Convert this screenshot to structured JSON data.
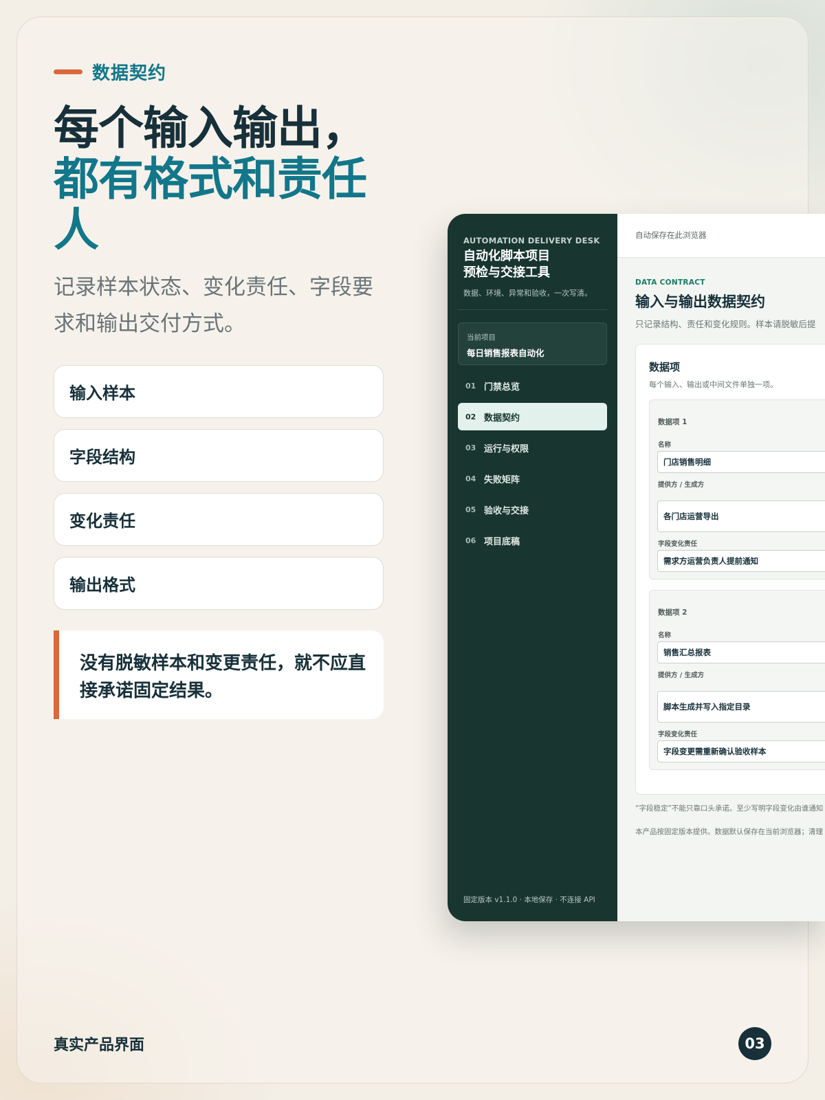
{
  "slide": {
    "eyebrow": "数据契约",
    "headline_line1": "每个输入输出，",
    "headline_line2": "都有格式和责任人",
    "subtitle": "记录样本状态、变化责任、字段要求和输出交付方式。",
    "chips": [
      "输入样本",
      "字段结构",
      "变化责任",
      "输出格式"
    ],
    "callout": "没有脱敏样本和变更责任，就不应直接承诺固定结果。",
    "footer_label": "真实产品界面",
    "page_number": "03",
    "colors": {
      "accent_orange": "#d9683a",
      "accent_teal": "#12778a",
      "ink": "#17303a",
      "sidebar": "#18352f"
    }
  },
  "app": {
    "sidebar": {
      "kicker": "AUTOMATION DELIVERY DESK",
      "title_line1": "自动化脚本项目",
      "title_line2": "预检与交接工具",
      "subtitle": "数据、环境、异常和验收，一次写清。",
      "project_label": "当前项目",
      "project_name": "每日销售报表自动化",
      "nav": [
        {
          "num": "01",
          "label": "门禁总览",
          "active": false
        },
        {
          "num": "02",
          "label": "数据契约",
          "active": true
        },
        {
          "num": "03",
          "label": "运行与权限",
          "active": false
        },
        {
          "num": "04",
          "label": "失败矩阵",
          "active": false
        },
        {
          "num": "05",
          "label": "验收与交接",
          "active": false
        },
        {
          "num": "06",
          "label": "项目底稿",
          "active": false
        }
      ],
      "footer": "固定版本 v1.1.0 · 本地保存 · 不连接 API"
    },
    "topbar_text": "自动保存在此浏览器",
    "content": {
      "kicker": "DATA CONTRACT",
      "title": "输入与输出数据契约",
      "subtitle": "只记录结构、责任和变化规则。样本请脱敏后提",
      "panel_title": "数据项",
      "panel_subtitle": "每个输入、输出或中间文件单独一项。",
      "items": [
        {
          "header": "数据项 1",
          "name_label": "名称",
          "name_value": "门店销售明细",
          "provider_label": "提供方 / 生成方",
          "provider_value": "各门店运营导出",
          "change_label": "字段变化责任",
          "change_value": "需求方运营负责人提前通知"
        },
        {
          "header": "数据项 2",
          "name_label": "名称",
          "name_value": "销售汇总报表",
          "provider_label": "提供方 / 生成方",
          "provider_value": "脚本生成并写入指定目录",
          "change_label": "字段变化责任",
          "change_value": "字段变更需重新确认验收样本"
        }
      ],
      "note1": "“字段稳定”不能只靠口头承诺。至少写明字段变化由谁通知",
      "note2": "本产品按固定版本提供。数据默认保存在当前浏览器；清理"
    }
  }
}
